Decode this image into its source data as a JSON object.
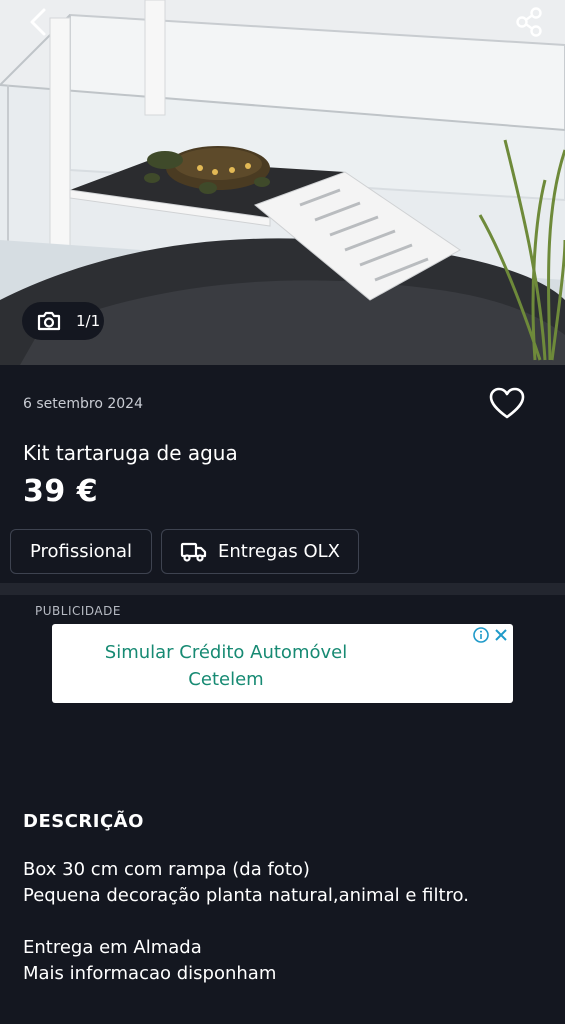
{
  "photo": {
    "counter": "1/1",
    "icons": {
      "back": "chevron-left-icon",
      "share": "share-icon",
      "camera": "camera-icon"
    }
  },
  "listing": {
    "date": "6 setembro 2024",
    "title": "Kit tartaruga de agua",
    "price": "39 €",
    "favorite_icon": "heart-icon"
  },
  "chips": {
    "professional": "Profissional",
    "delivery": "Entregas OLX",
    "delivery_icon": "truck-icon"
  },
  "ad": {
    "label": "PUBLICIDADE",
    "line1": "Simular Crédito Automóvel",
    "line2": "Cetelem",
    "accent": "#178a73"
  },
  "description": {
    "heading": "DESCRIÇÃO",
    "text": "Box 30 cm com rampa (da foto)\nPequena decoração planta natural,animal e filtro.\n\nEntrega em Almada\nMais informacao disponham"
  },
  "colors": {
    "background": "#141720",
    "divider": "#23262f",
    "chip_border": "#3e4350"
  }
}
